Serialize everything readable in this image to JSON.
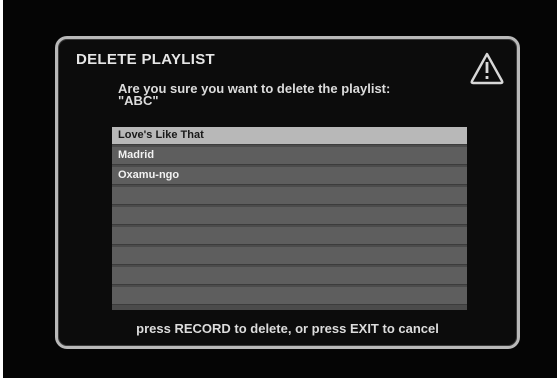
{
  "dialog": {
    "title": "DELETE PLAYLIST",
    "icon": "warning-triangle-icon",
    "question_line1": "Are you sure you want to delete the playlist:",
    "question_line2": "\"ABC\"",
    "footer": "press RECORD to delete, or press EXIT to cancel"
  },
  "playlist": {
    "items": [
      {
        "label": "Love's Like That",
        "selected": true
      },
      {
        "label": "Madrid",
        "selected": false
      },
      {
        "label": "Oxamu-ngo",
        "selected": false
      },
      {
        "label": "",
        "selected": false
      },
      {
        "label": "",
        "selected": false
      },
      {
        "label": "",
        "selected": false
      },
      {
        "label": "",
        "selected": false
      },
      {
        "label": "",
        "selected": false
      },
      {
        "label": "",
        "selected": false
      }
    ]
  },
  "colors": {
    "background": "#050505",
    "border": "#b9b9b9",
    "row": "#5e5e5e",
    "row_selected": "#b8b8b8",
    "text": "#dcdcdc"
  }
}
